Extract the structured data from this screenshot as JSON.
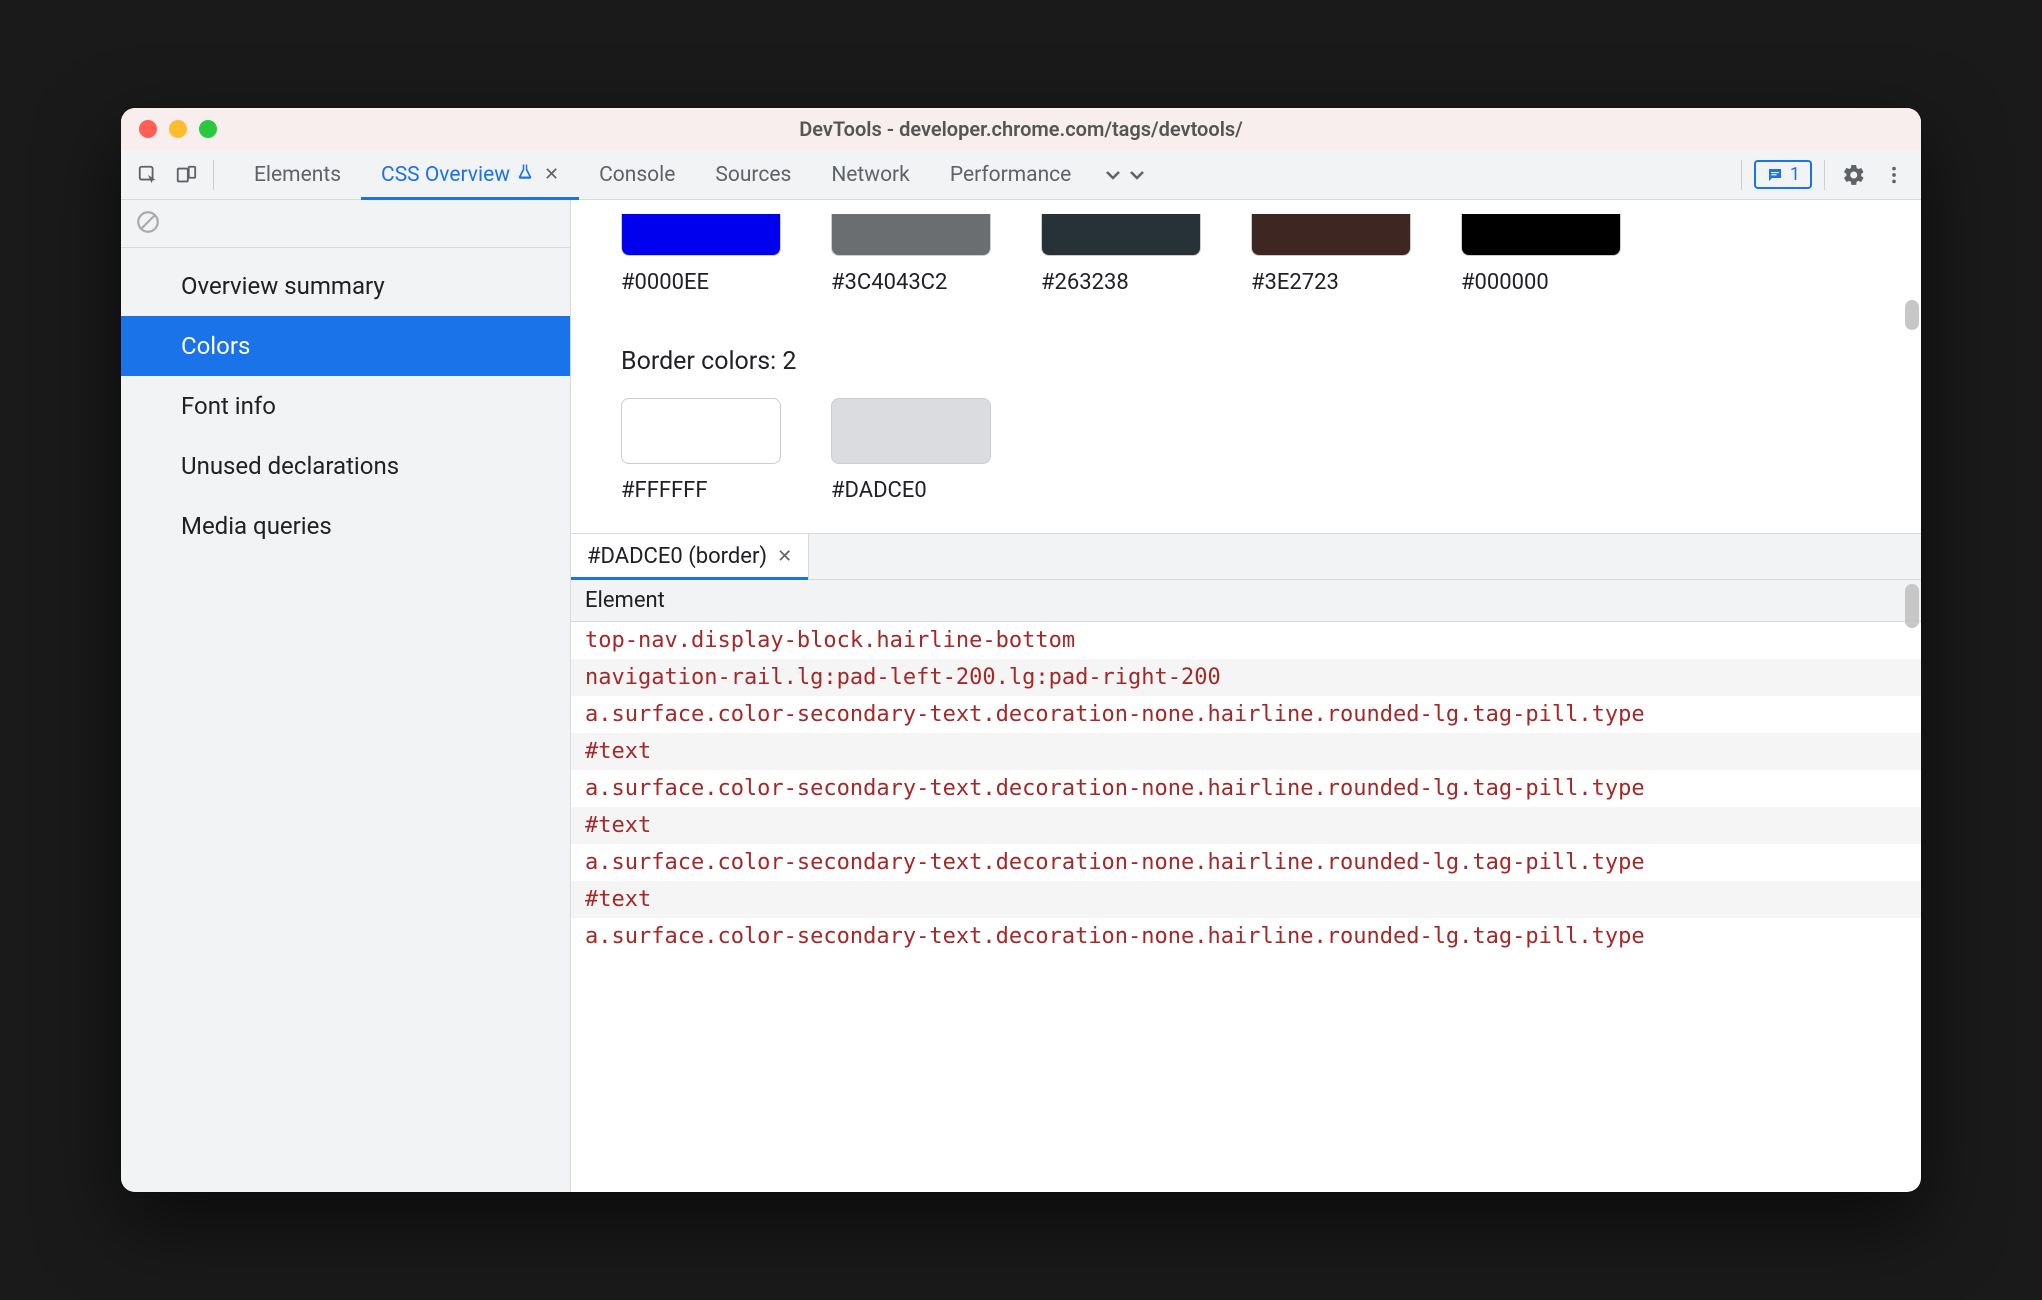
{
  "window_title": "DevTools - developer.chrome.com/tags/devtools/",
  "toolbar_tabs": [
    {
      "label": "Elements",
      "active": false
    },
    {
      "label": "CSS Overview",
      "active": true,
      "experiment": true,
      "closable": true
    },
    {
      "label": "Console",
      "active": false
    },
    {
      "label": "Sources",
      "active": false
    },
    {
      "label": "Network",
      "active": false
    },
    {
      "label": "Performance",
      "active": false
    }
  ],
  "issues_badge_count": "1",
  "sidebar": {
    "items": [
      {
        "label": "Overview summary"
      },
      {
        "label": "Colors"
      },
      {
        "label": "Font info"
      },
      {
        "label": "Unused declarations"
      },
      {
        "label": "Media queries"
      }
    ],
    "selected_index": 1
  },
  "upper_swatches": [
    {
      "hex": "#0000EE",
      "color": "#0000EE"
    },
    {
      "hex": "#3C4043C2",
      "color": "rgba(60,64,67,0.76)"
    },
    {
      "hex": "#263238",
      "color": "#263238"
    },
    {
      "hex": "#3E2723",
      "color": "#3E2723"
    },
    {
      "hex": "#000000",
      "color": "#000000"
    }
  ],
  "border_section_title": "Border colors: 2",
  "border_swatches": [
    {
      "hex": "#FFFFFF",
      "color": "#FFFFFF"
    },
    {
      "hex": "#DADCE0",
      "color": "#DADCE0"
    }
  ],
  "drawer": {
    "tab_label": "#DADCE0 (border)",
    "column_header": "Element",
    "rows": [
      "top-nav.display-block.hairline-bottom",
      "navigation-rail.lg:pad-left-200.lg:pad-right-200",
      "a.surface.color-secondary-text.decoration-none.hairline.rounded-lg.tag-pill.type",
      "#text",
      "a.surface.color-secondary-text.decoration-none.hairline.rounded-lg.tag-pill.type",
      "#text",
      "a.surface.color-secondary-text.decoration-none.hairline.rounded-lg.tag-pill.type",
      "#text",
      "a.surface.color-secondary-text.decoration-none.hairline.rounded-lg.tag-pill.type"
    ]
  }
}
